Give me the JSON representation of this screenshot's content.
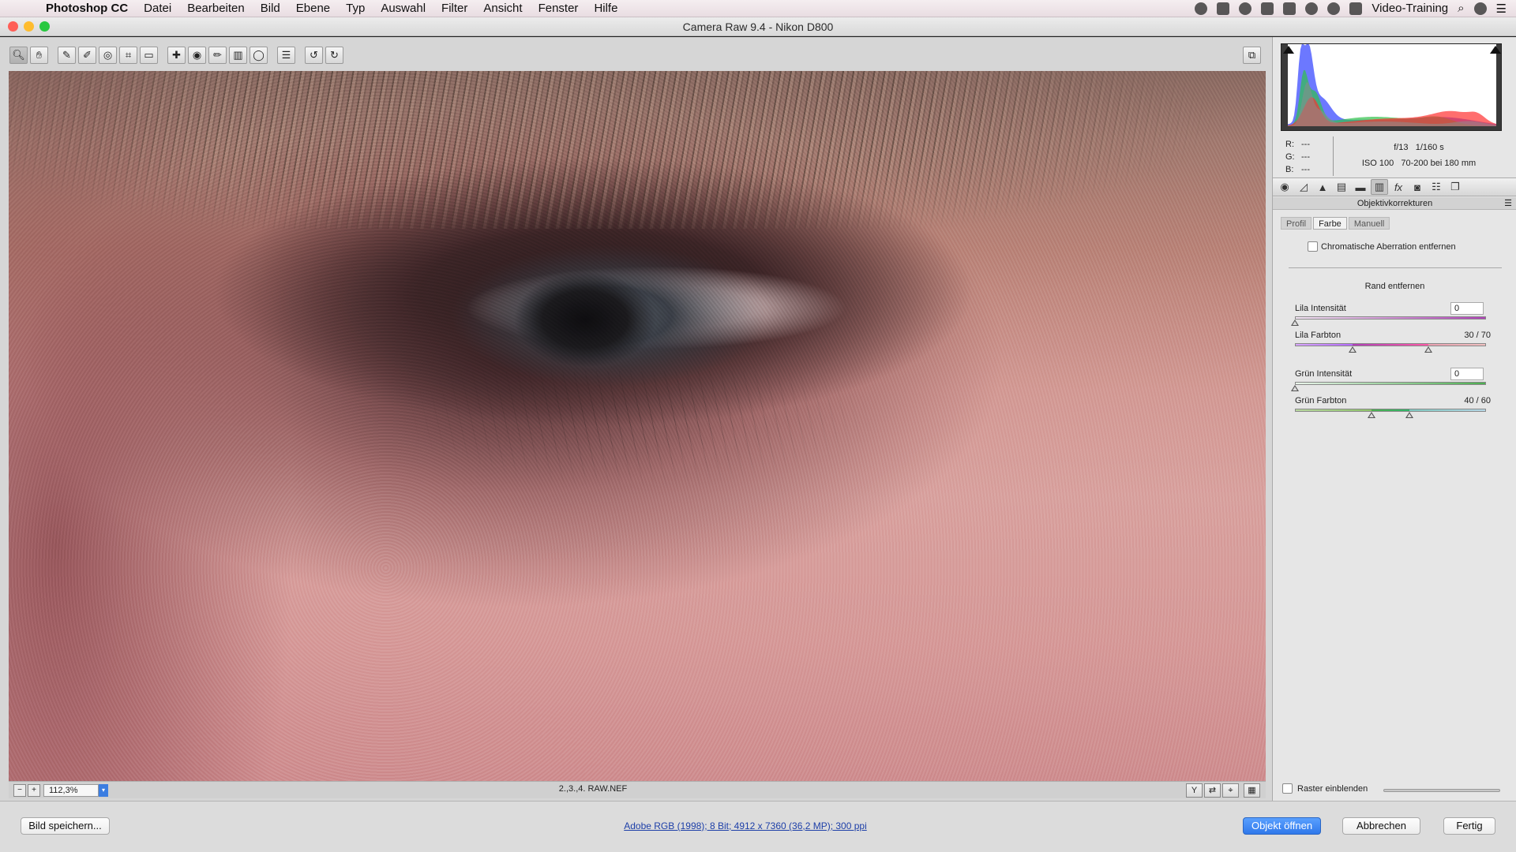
{
  "menubar": {
    "app": "Photoshop CC",
    "items": [
      "Datei",
      "Bearbeiten",
      "Bild",
      "Ebene",
      "Typ",
      "Auswahl",
      "Filter",
      "Ansicht",
      "Fenster",
      "Hilfe"
    ],
    "user": "Video-Training"
  },
  "window": {
    "title": "Camera Raw 9.4 - Nikon D800"
  },
  "imagebar": {
    "zoom": "112,3%",
    "filename": "2.,3.,4. RAW.NEF"
  },
  "info": {
    "r_label": "R:",
    "r_value": "---",
    "g_label": "G:",
    "g_value": "---",
    "b_label": "B:",
    "b_value": "---",
    "aperture": "f/13",
    "shutter": "1/160 s",
    "iso": "ISO 100",
    "lens": "70-200 bei 180 mm"
  },
  "panel": {
    "section_title": "Objektivkorrekturen",
    "tabs": [
      "Profil",
      "Farbe",
      "Manuell"
    ],
    "active_tab": "Farbe",
    "ca_label": "Chromatische Aberration entfernen",
    "ca_checked": false,
    "fringe_heading": "Rand entfernen",
    "sliders": [
      {
        "label": "Lila Intensität",
        "value": "0",
        "amount": 0
      },
      {
        "label": "Lila Farbton",
        "value": "30 / 70",
        "low": 30,
        "high": 70
      },
      {
        "label": "Grün Intensität",
        "value": "0",
        "amount": 0
      },
      {
        "label": "Grün Farbton",
        "value": "40 / 60",
        "low": 40,
        "high": 60
      }
    ],
    "grid_label": "Raster einblenden",
    "grid_checked": false
  },
  "bottom": {
    "save": "Bild speichern...",
    "workflow": "Adobe RGB (1998); 8 Bit; 4912 x 7360 (36,2 MP); 300 ppi",
    "open": "Objekt öffnen",
    "cancel": "Abbrechen",
    "done": "Fertig"
  },
  "colors": {
    "accent": "#3b7de1",
    "purple": "#b03fb8",
    "green": "#4caf50",
    "close": "#ff5f57",
    "minimize": "#febc2e",
    "zoom": "#28c840"
  }
}
